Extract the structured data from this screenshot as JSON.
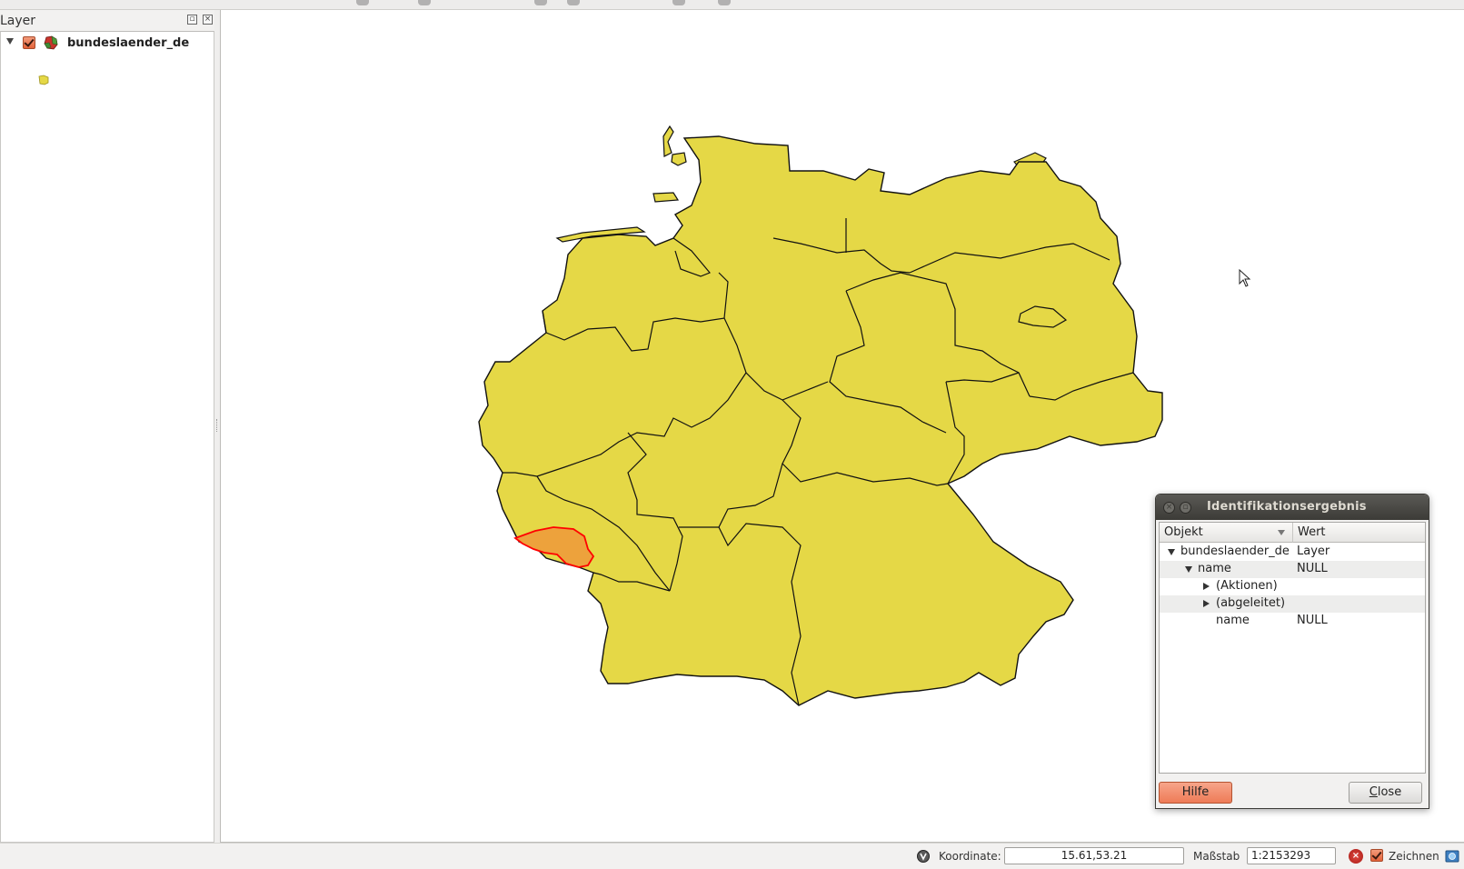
{
  "layer_panel": {
    "title": "Layer",
    "layers": [
      {
        "name": "bundeslaender_de",
        "visible": true
      }
    ]
  },
  "map": {
    "fill_color": "#e5d846",
    "stroke_color": "#1a1a1a",
    "selected_fill": "#eda23c",
    "selected_stroke": "#ff0000"
  },
  "identify_dialog": {
    "title": "Identifikationsergebnis",
    "columns": {
      "object": "Objekt",
      "value": "Wert"
    },
    "rows": [
      {
        "key": "bundeslaender_de",
        "value": "Layer"
      },
      {
        "key": "name",
        "value": "NULL"
      },
      {
        "key": "(Aktionen)",
        "value": ""
      },
      {
        "key": "(abgeleitet)",
        "value": ""
      },
      {
        "key": "name",
        "value": "NULL"
      }
    ],
    "help_label": "Hilfe",
    "close_label_accel": "C",
    "close_label_rest": "lose"
  },
  "statusbar": {
    "coord_label": "Koordinate:",
    "coord_value": "15.61,53.21",
    "scale_label": "Maßstab",
    "scale_value": "1:2153293",
    "render_label": "Zeichnen"
  }
}
